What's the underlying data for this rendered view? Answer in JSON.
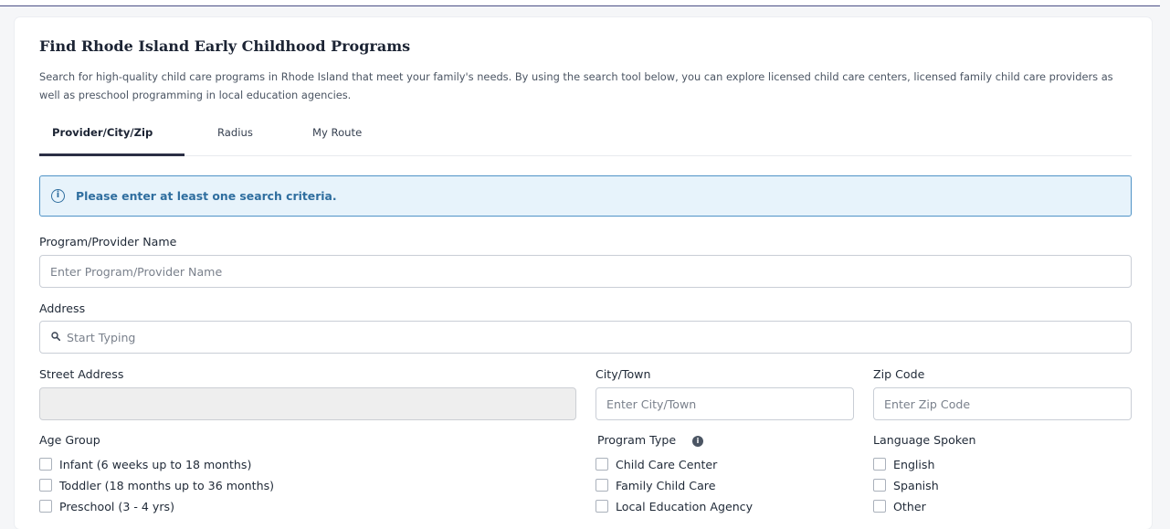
{
  "page": {
    "title": "Find Rhode Island Early Childhood Programs",
    "description": "Search for high-quality child care programs in Rhode Island that meet your family's needs. By using the search tool below, you can explore licensed child care centers, licensed family child care providers as well as preschool programming in local education agencies."
  },
  "tabs": [
    {
      "label": "Provider/City/Zip",
      "active": true
    },
    {
      "label": "Radius",
      "active": false
    },
    {
      "label": "My Route",
      "active": false
    }
  ],
  "alert": {
    "icon": "info-icon",
    "text": "Please enter at least one search criteria."
  },
  "form": {
    "provider_name": {
      "label": "Program/Provider Name",
      "value": "",
      "placeholder": "Enter Program/Provider Name"
    },
    "address": {
      "label": "Address",
      "value": "",
      "placeholder": "Start Typing",
      "icon": "search-icon"
    },
    "street_address": {
      "label": "Street Address",
      "value": "",
      "placeholder": ""
    },
    "city": {
      "label": "City/Town",
      "value": "",
      "placeholder": "Enter City/Town"
    },
    "zip": {
      "label": "Zip Code",
      "value": "",
      "placeholder": "Enter Zip Code"
    }
  },
  "filters": {
    "age_group": {
      "label": "Age Group",
      "options": [
        "Infant (6 weeks up to 18 months)",
        "Toddler (18 months up to 36 months)",
        "Preschool (3 - 4 yrs)"
      ]
    },
    "program_type": {
      "label": "Program Type",
      "icon": "help-icon",
      "options": [
        "Child Care Center",
        "Family Child Care",
        "Local Education Agency"
      ]
    },
    "language": {
      "label": "Language Spoken",
      "options": [
        "English",
        "Spanish",
        "Other"
      ]
    }
  },
  "colors": {
    "accent": "#2b2f45",
    "alert_text": "#2f6e9f",
    "alert_bg": "#e7f3fb",
    "alert_border": "#4f93c6"
  }
}
